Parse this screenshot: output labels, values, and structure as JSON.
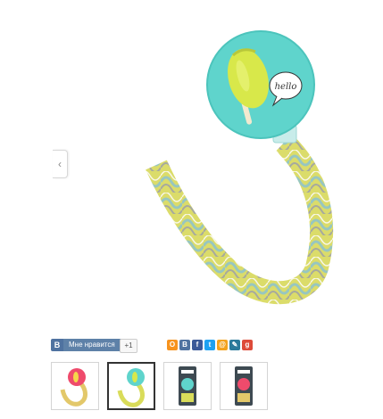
{
  "share": {
    "vk_logo": "B",
    "vk_like_label": "Мне нравится",
    "plus_one_label": "+1",
    "icons": [
      {
        "name": "odnoklassniki-icon",
        "glyph": "О",
        "color": "#f7931e"
      },
      {
        "name": "vk-share-icon",
        "glyph": "В",
        "color": "#4f72a0"
      },
      {
        "name": "facebook-icon",
        "glyph": "f",
        "color": "#3b5998"
      },
      {
        "name": "twitter-icon",
        "glyph": "t",
        "color": "#1da1f2"
      },
      {
        "name": "moimir-icon",
        "glyph": "@",
        "color": "#f4a21d"
      },
      {
        "name": "livejournal-icon",
        "glyph": "✎",
        "color": "#2b7a9b"
      },
      {
        "name": "google-plus-icon",
        "glyph": "g",
        "color": "#dd4b39"
      }
    ]
  },
  "main_image": {
    "bubble_text": "hello",
    "colors": {
      "disc": "#5fd4cc",
      "popsicle": "#d8e84a",
      "strap_yellow": "#d9dc5a",
      "strap_blue": "#8fc6cf",
      "strap_grey": "#9aa0a6"
    }
  },
  "thumbnails": [
    {
      "name": "thumb-pink-clip",
      "active": false
    },
    {
      "name": "thumb-teal-clip",
      "active": true
    },
    {
      "name": "thumb-package-teal",
      "active": false
    },
    {
      "name": "thumb-package-red",
      "active": false
    }
  ]
}
